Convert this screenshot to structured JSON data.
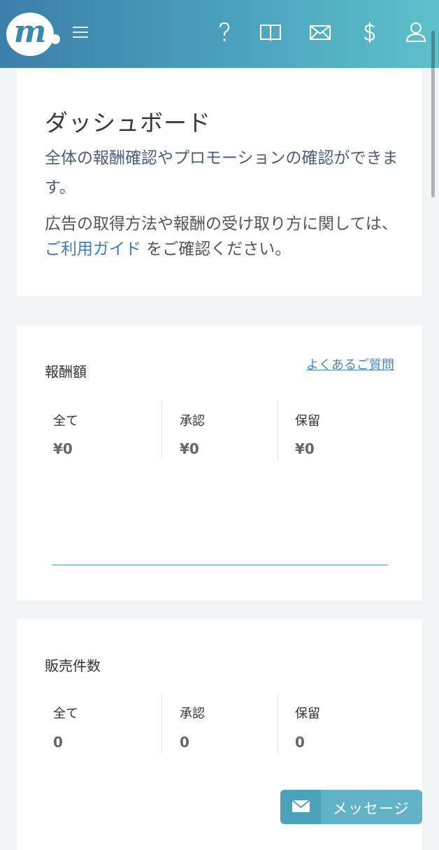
{
  "header": {
    "logo_text": "m",
    "icons": [
      "menu-icon",
      "help-icon",
      "book-icon",
      "mail-icon",
      "dollar-icon",
      "user-icon"
    ]
  },
  "intro": {
    "title": "ダッシュボード",
    "description": "全体の報酬確認やプロモーションの確認ができます。",
    "guide_before": "広告の取得方法や報酬の受け取り方に関しては、",
    "guide_link": "ご利用ガイド",
    "guide_after": " をご確認ください。"
  },
  "rewards": {
    "title": "報酬額",
    "faq_link": "よくあるご質問",
    "stats": [
      {
        "label": "全て",
        "value": "¥0"
      },
      {
        "label": "承認",
        "value": "¥0"
      },
      {
        "label": "保留",
        "value": "¥0"
      }
    ]
  },
  "sales": {
    "title": "販売件数",
    "stats": [
      {
        "label": "全て",
        "value": "0"
      },
      {
        "label": "承認",
        "value": "0"
      },
      {
        "label": "保留",
        "value": "0"
      }
    ]
  },
  "message_button": {
    "label": "メッセージ"
  },
  "colors": {
    "header_start": "#3b7fa8",
    "header_end": "#5ec0c9",
    "link": "#3a7cb5",
    "chart_line": "#7ed3e8",
    "message_button": "#62b3c7"
  }
}
